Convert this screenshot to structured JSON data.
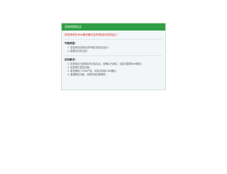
{
  "header": {
    "title": "没有找到站点"
  },
  "alert": {
    "text": "您的请求在Web服务器中没有找到对应的站点！"
  },
  "causes": {
    "title": "可能原因：",
    "items": [
      {
        "num": "1.",
        "text": "您没有将此域名或IP绑定到对应站点!"
      },
      {
        "num": "2.",
        "text": "配置文件未生效!"
      }
    ]
  },
  "solutions": {
    "title": "如何解决：",
    "items": [
      {
        "num": "1.",
        "text": "检查是否已经绑定到对应站点，若确认已绑定，请尝试重载Web服务；"
      },
      {
        "num": "2.",
        "text": "检查端口是否正确；"
      },
      {
        "num": "3.",
        "text": "若您使用了CDN产品，请尝试清除CDN缓存；"
      },
      {
        "num": "4.",
        "text": "普通网站访客，请联系网站管理员；"
      }
    ]
  },
  "colors": {
    "header_bg": "#2f9e44",
    "alert_text": "#e0221b",
    "panel_bg": "#f2f6f9"
  }
}
